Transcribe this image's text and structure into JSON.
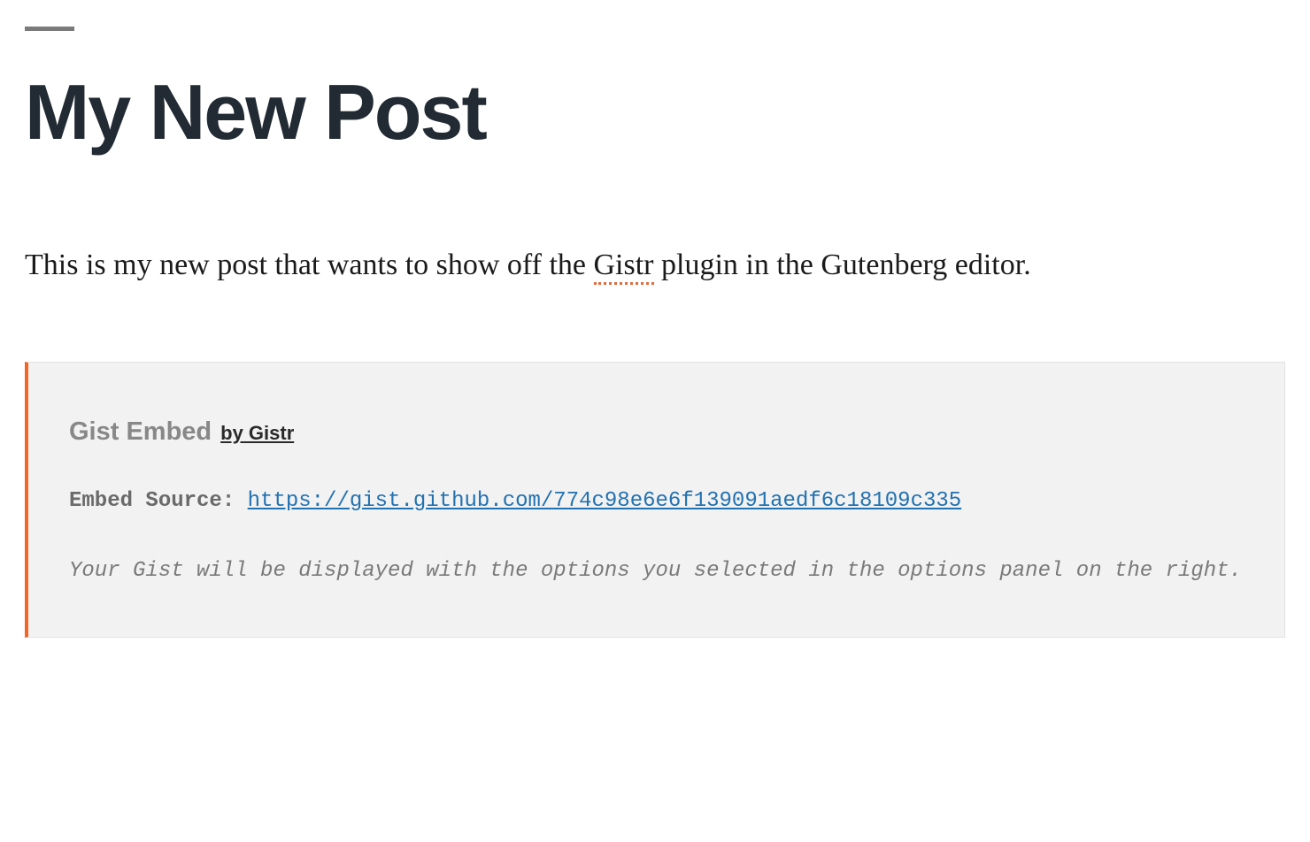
{
  "post": {
    "title": "My New Post",
    "body_prefix": "This is my new post that wants to show off the ",
    "body_spellcheck_word": "Gistr",
    "body_suffix": " plugin in the Gutenberg editor."
  },
  "embed": {
    "title": "Gist Embed",
    "byline": "by Gistr",
    "source_label": "Embed Source:",
    "source_url": "https://gist.github.com/774c98e6e6f139091aedf6c18109c335",
    "note": "Your Gist will be displayed with the options you selected in the options panel on the right."
  }
}
